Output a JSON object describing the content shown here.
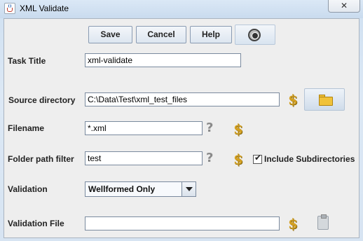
{
  "window": {
    "title": "XML Validate",
    "close_glyph": "✕"
  },
  "toolbar": {
    "save_label": "Save",
    "cancel_label": "Cancel",
    "help_label": "Help",
    "settings_icon": "gear-icon"
  },
  "form": {
    "task_title": {
      "label": "Task Title",
      "value": "xml-validate"
    },
    "source_directory": {
      "label": "Source directory",
      "value": "C:\\Data\\Test\\xml_test_files"
    },
    "filename": {
      "label": "Filename",
      "value": "*.xml"
    },
    "folder_path_filter": {
      "label": "Folder path filter",
      "value": "test"
    },
    "include_subdirectories": {
      "label": "Include Subdirectories",
      "checked": true
    },
    "validation": {
      "label": "Validation",
      "selected": "Wellformed Only"
    },
    "validation_file": {
      "label": "Validation File",
      "value": ""
    }
  },
  "glyphs": {
    "variable": "$",
    "help": "?",
    "check": "✔"
  },
  "colors": {
    "variable_icon": "#d4a020",
    "folder_icon": "#f0c23a",
    "title_bar": "#c9dbee",
    "panel_bg": "#eeeeee"
  }
}
